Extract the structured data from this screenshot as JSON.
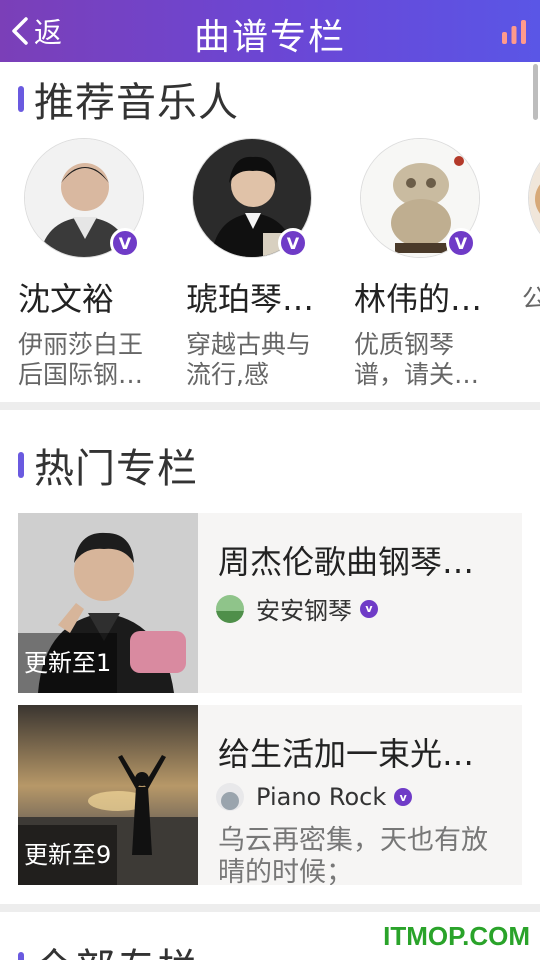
{
  "header": {
    "back_label": "返",
    "title": "曲谱专栏"
  },
  "sections": {
    "recommended": "推荐音乐人",
    "hot": "热门专栏",
    "all": "全部专栏"
  },
  "artists": [
    {
      "name": "沈文裕",
      "desc": "伊丽莎白王后国际钢…"
    },
    {
      "name": "琥珀琴…",
      "desc": "穿越古典与流行,感受…"
    },
    {
      "name": "林伟的…",
      "desc": "优质钢琴谱，请关…"
    },
    {
      "name": "",
      "desc": "公微"
    }
  ],
  "hot_columns": [
    {
      "title": "周杰伦歌曲钢琴…",
      "author": "安安钢琴",
      "update": "更新至1",
      "desc": ""
    },
    {
      "title": "给生活加一束光…",
      "author": "Piano Rock",
      "update": "更新至9",
      "desc": "乌云再密集，天也有放晴的时候；"
    }
  ],
  "watermark": "ITMOP.COM",
  "colors": {
    "accent": "#6f3bc7",
    "header_start": "#7b3fb8",
    "header_end": "#5a56e6"
  }
}
